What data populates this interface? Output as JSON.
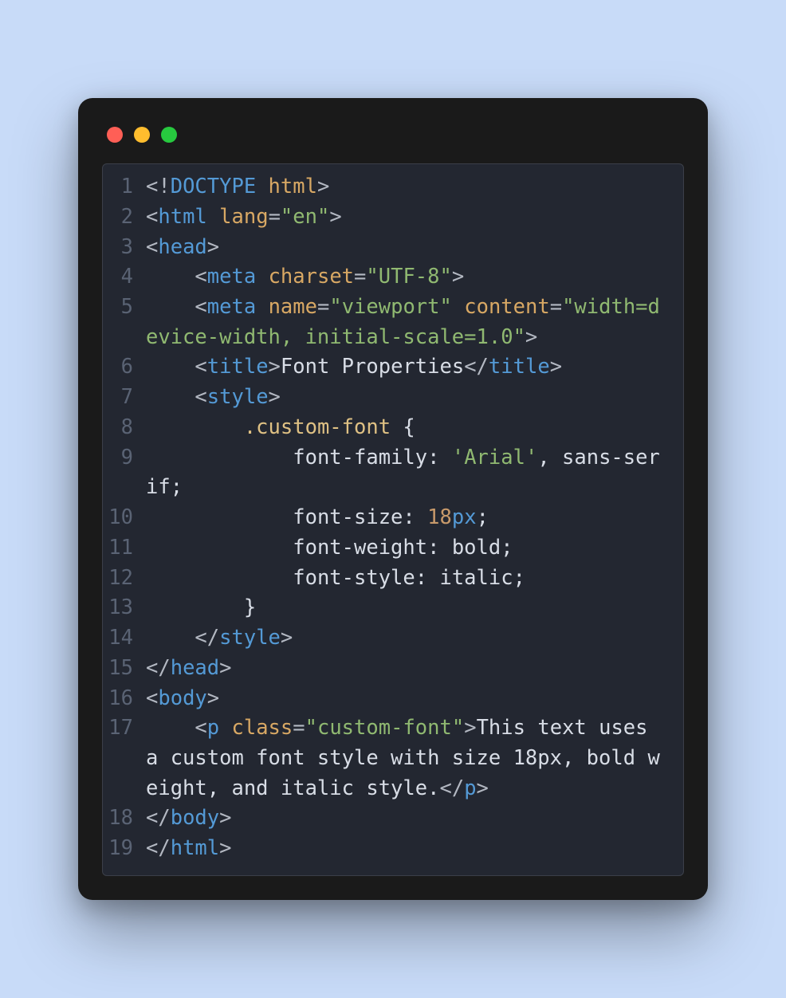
{
  "window": {
    "controls": [
      "close",
      "minimize",
      "zoom"
    ]
  },
  "code": {
    "language": "html",
    "lines": [
      {
        "n": 1,
        "tokens": [
          {
            "c": "p",
            "t": "<!"
          },
          {
            "c": "kw",
            "t": "DOCTYPE"
          },
          {
            "c": "tx",
            "t": " "
          },
          {
            "c": "at",
            "t": "html"
          },
          {
            "c": "p",
            "t": ">"
          }
        ]
      },
      {
        "n": 2,
        "tokens": [
          {
            "c": "p",
            "t": "<"
          },
          {
            "c": "tg",
            "t": "html"
          },
          {
            "c": "tx",
            "t": " "
          },
          {
            "c": "at",
            "t": "lang"
          },
          {
            "c": "p",
            "t": "="
          },
          {
            "c": "st",
            "t": "\"en\""
          },
          {
            "c": "p",
            "t": ">"
          }
        ]
      },
      {
        "n": 3,
        "tokens": [
          {
            "c": "p",
            "t": "<"
          },
          {
            "c": "tg",
            "t": "head"
          },
          {
            "c": "p",
            "t": ">"
          }
        ]
      },
      {
        "n": 4,
        "tokens": [
          {
            "c": "tx",
            "t": "    "
          },
          {
            "c": "p",
            "t": "<"
          },
          {
            "c": "tg",
            "t": "meta"
          },
          {
            "c": "tx",
            "t": " "
          },
          {
            "c": "at",
            "t": "charset"
          },
          {
            "c": "p",
            "t": "="
          },
          {
            "c": "st",
            "t": "\"UTF-8\""
          },
          {
            "c": "p",
            "t": ">"
          }
        ]
      },
      {
        "n": 5,
        "tokens": [
          {
            "c": "tx",
            "t": "    "
          },
          {
            "c": "p",
            "t": "<"
          },
          {
            "c": "tg",
            "t": "meta"
          },
          {
            "c": "tx",
            "t": " "
          },
          {
            "c": "at",
            "t": "name"
          },
          {
            "c": "p",
            "t": "="
          },
          {
            "c": "st",
            "t": "\"viewport\""
          },
          {
            "c": "tx",
            "t": " "
          },
          {
            "c": "at",
            "t": "content"
          },
          {
            "c": "p",
            "t": "="
          },
          {
            "c": "st",
            "t": "\"width=device-width, initial-scale=1.0\""
          },
          {
            "c": "p",
            "t": ">"
          }
        ]
      },
      {
        "n": 6,
        "tokens": [
          {
            "c": "tx",
            "t": "    "
          },
          {
            "c": "p",
            "t": "<"
          },
          {
            "c": "tg",
            "t": "title"
          },
          {
            "c": "p",
            "t": ">"
          },
          {
            "c": "tx",
            "t": "Font Properties"
          },
          {
            "c": "p",
            "t": "</"
          },
          {
            "c": "tg",
            "t": "title"
          },
          {
            "c": "p",
            "t": ">"
          }
        ]
      },
      {
        "n": 7,
        "tokens": [
          {
            "c": "tx",
            "t": "    "
          },
          {
            "c": "p",
            "t": "<"
          },
          {
            "c": "tg",
            "t": "style"
          },
          {
            "c": "p",
            "t": ">"
          }
        ]
      },
      {
        "n": 8,
        "tokens": [
          {
            "c": "tx",
            "t": "        "
          },
          {
            "c": "sel",
            "t": ".custom-font"
          },
          {
            "c": "tx",
            "t": " {"
          }
        ]
      },
      {
        "n": 9,
        "tokens": [
          {
            "c": "tx",
            "t": "            "
          },
          {
            "c": "prop",
            "t": "font-family"
          },
          {
            "c": "tx",
            "t": ": "
          },
          {
            "c": "st",
            "t": "'Arial'"
          },
          {
            "c": "tx",
            "t": ", sans-serif;"
          }
        ]
      },
      {
        "n": 10,
        "tokens": [
          {
            "c": "tx",
            "t": "            "
          },
          {
            "c": "prop",
            "t": "font-size"
          },
          {
            "c": "tx",
            "t": ": "
          },
          {
            "c": "num",
            "t": "18"
          },
          {
            "c": "unit",
            "t": "px"
          },
          {
            "c": "tx",
            "t": ";"
          }
        ]
      },
      {
        "n": 11,
        "tokens": [
          {
            "c": "tx",
            "t": "            "
          },
          {
            "c": "prop",
            "t": "font-weight"
          },
          {
            "c": "tx",
            "t": ": bold;"
          }
        ]
      },
      {
        "n": 12,
        "tokens": [
          {
            "c": "tx",
            "t": "            "
          },
          {
            "c": "prop",
            "t": "font-style"
          },
          {
            "c": "tx",
            "t": ": italic;"
          }
        ]
      },
      {
        "n": 13,
        "tokens": [
          {
            "c": "tx",
            "t": "        }"
          }
        ]
      },
      {
        "n": 14,
        "tokens": [
          {
            "c": "tx",
            "t": "    "
          },
          {
            "c": "p",
            "t": "</"
          },
          {
            "c": "tg",
            "t": "style"
          },
          {
            "c": "p",
            "t": ">"
          }
        ]
      },
      {
        "n": 15,
        "tokens": [
          {
            "c": "p",
            "t": "</"
          },
          {
            "c": "tg",
            "t": "head"
          },
          {
            "c": "p",
            "t": ">"
          }
        ]
      },
      {
        "n": 16,
        "tokens": [
          {
            "c": "p",
            "t": "<"
          },
          {
            "c": "tg",
            "t": "body"
          },
          {
            "c": "p",
            "t": ">"
          }
        ]
      },
      {
        "n": 17,
        "tokens": [
          {
            "c": "tx",
            "t": "    "
          },
          {
            "c": "p",
            "t": "<"
          },
          {
            "c": "tg",
            "t": "p"
          },
          {
            "c": "tx",
            "t": " "
          },
          {
            "c": "at",
            "t": "class"
          },
          {
            "c": "p",
            "t": "="
          },
          {
            "c": "st",
            "t": "\"custom-font\""
          },
          {
            "c": "p",
            "t": ">"
          },
          {
            "c": "tx",
            "t": "This text uses a custom font style with size 18px, bold weight, and italic style."
          },
          {
            "c": "p",
            "t": "</"
          },
          {
            "c": "tg",
            "t": "p"
          },
          {
            "c": "p",
            "t": ">"
          }
        ]
      },
      {
        "n": 18,
        "tokens": [
          {
            "c": "p",
            "t": "</"
          },
          {
            "c": "tg",
            "t": "body"
          },
          {
            "c": "p",
            "t": ">"
          }
        ]
      },
      {
        "n": 19,
        "tokens": [
          {
            "c": "p",
            "t": "</"
          },
          {
            "c": "tg",
            "t": "html"
          },
          {
            "c": "p",
            "t": ">"
          }
        ]
      }
    ]
  }
}
